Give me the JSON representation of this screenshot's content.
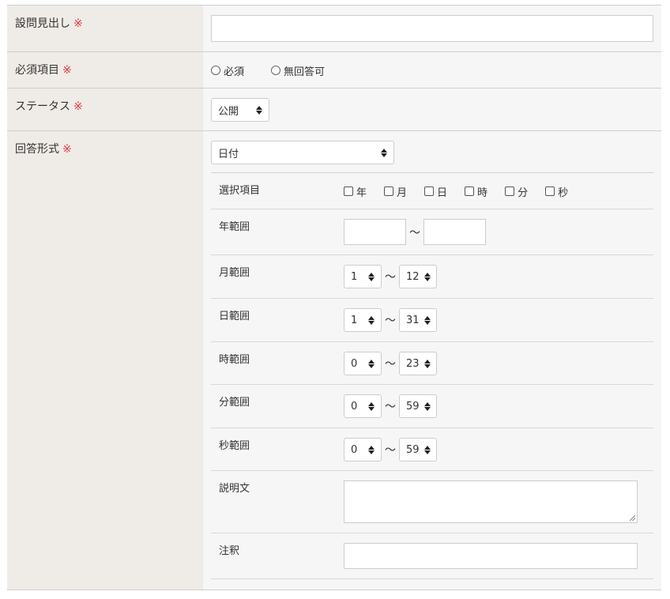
{
  "required_mark": "※",
  "fields": {
    "heading": {
      "label": "設問見出し",
      "value": ""
    },
    "required": {
      "label": "必須項目",
      "options": [
        "必須",
        "無回答可"
      ]
    },
    "status": {
      "label": "ステータス",
      "selected": "公開"
    },
    "answer_format": {
      "label": "回答形式",
      "selected": "日付"
    }
  },
  "date_settings": {
    "select_items": {
      "label": "選択項目",
      "options": [
        "年",
        "月",
        "日",
        "時",
        "分",
        "秒"
      ]
    },
    "year_range": {
      "label": "年範囲",
      "from": "",
      "to": ""
    },
    "month_range": {
      "label": "月範囲",
      "from": "1",
      "to": "12"
    },
    "day_range": {
      "label": "日範囲",
      "from": "1",
      "to": "31"
    },
    "hour_range": {
      "label": "時範囲",
      "from": "0",
      "to": "23"
    },
    "minute_range": {
      "label": "分範囲",
      "from": "0",
      "to": "59"
    },
    "second_range": {
      "label": "秒範囲",
      "from": "0",
      "to": "59"
    },
    "description": {
      "label": "説明文",
      "value": ""
    },
    "note": {
      "label": "注釈",
      "value": ""
    },
    "range_separator": "～"
  },
  "colors": {
    "label_bg": "#efebe6",
    "value_bg": "#f6f6f6",
    "required_mark": "#e0393e",
    "border": "#cfcfcf"
  }
}
